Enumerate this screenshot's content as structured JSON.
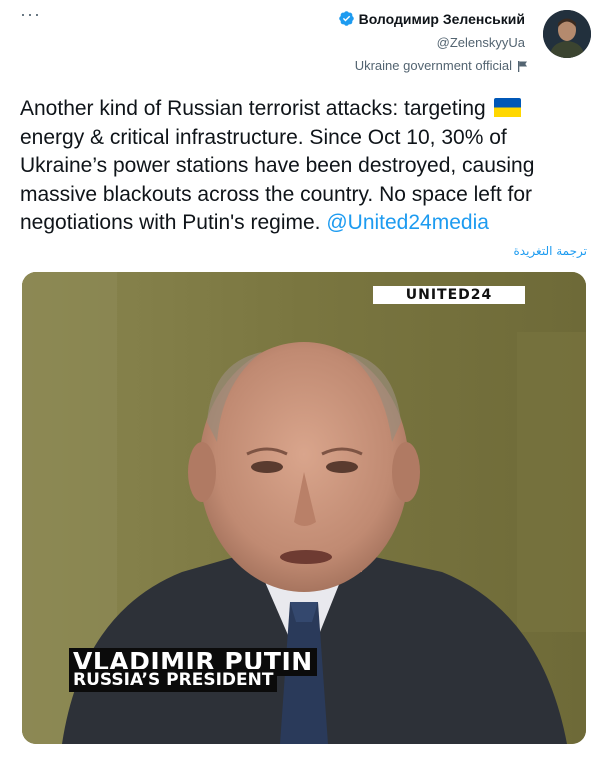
{
  "tweet": {
    "author": {
      "display_name": "Володимир Зеленський",
      "handle": "@ZelenskyyUa",
      "label": "Ukraine government official",
      "verified": true
    },
    "more_icon": "more-horizontal-icon",
    "text_before_flag": "Another kind of Russian terrorist attacks: targeting",
    "text_after_flag": "energy & critical infrastructure. Since Oct 10, 30% of Ukraine’s power stations have been destroyed, causing massive blackouts across the country. No space left for negotiations with Putin's regime. ",
    "mention": "@United24media",
    "translate_link": "ترجمة التغريدة",
    "flag_emoji": "ukraine-flag",
    "colors": {
      "link": "#1d9bf0",
      "secondary": "#536471",
      "verified": "#1d9bf0"
    }
  },
  "video": {
    "watermark": "UNITED24",
    "lower_third_name": "VLADIMIR PUTIN",
    "lower_third_title": "RUSSIA’S PRESIDENT"
  }
}
